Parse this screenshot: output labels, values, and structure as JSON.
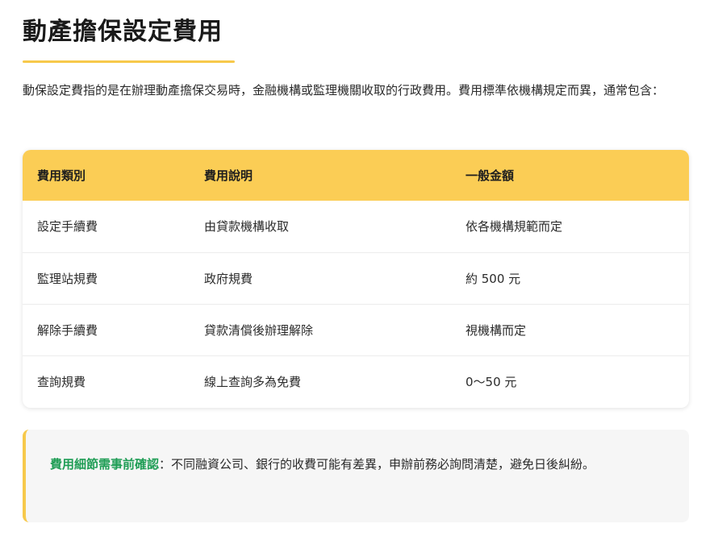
{
  "page": {
    "title": "動產擔保設定費用",
    "intro": "動保設定費指的是在辦理動產擔保交易時，金融機構或監理機關收取的行政費用。費用標準依機構規定而異，通常包含："
  },
  "fee_table": {
    "headers": [
      "費用類別",
      "費用說明",
      "一般金額"
    ],
    "rows": [
      [
        "設定手續費",
        "由貸款機構收取",
        "依各機構規範而定"
      ],
      [
        "監理站規費",
        "政府規費",
        "約 500 元"
      ],
      [
        "解除手續費",
        "貸款清償後辦理解除",
        "視機構而定"
      ],
      [
        "查詢規費",
        "線上查詢多為免費",
        "0〜50 元"
      ]
    ]
  },
  "note": {
    "label": "費用細節需事前確認",
    "text": "：不同融資公司、銀行的收費可能有差異，申辦前務必詢問清楚，避免日後糾紛。"
  },
  "colors": {
    "accent": "#fbcd55",
    "note_label": "#1f9d55"
  }
}
